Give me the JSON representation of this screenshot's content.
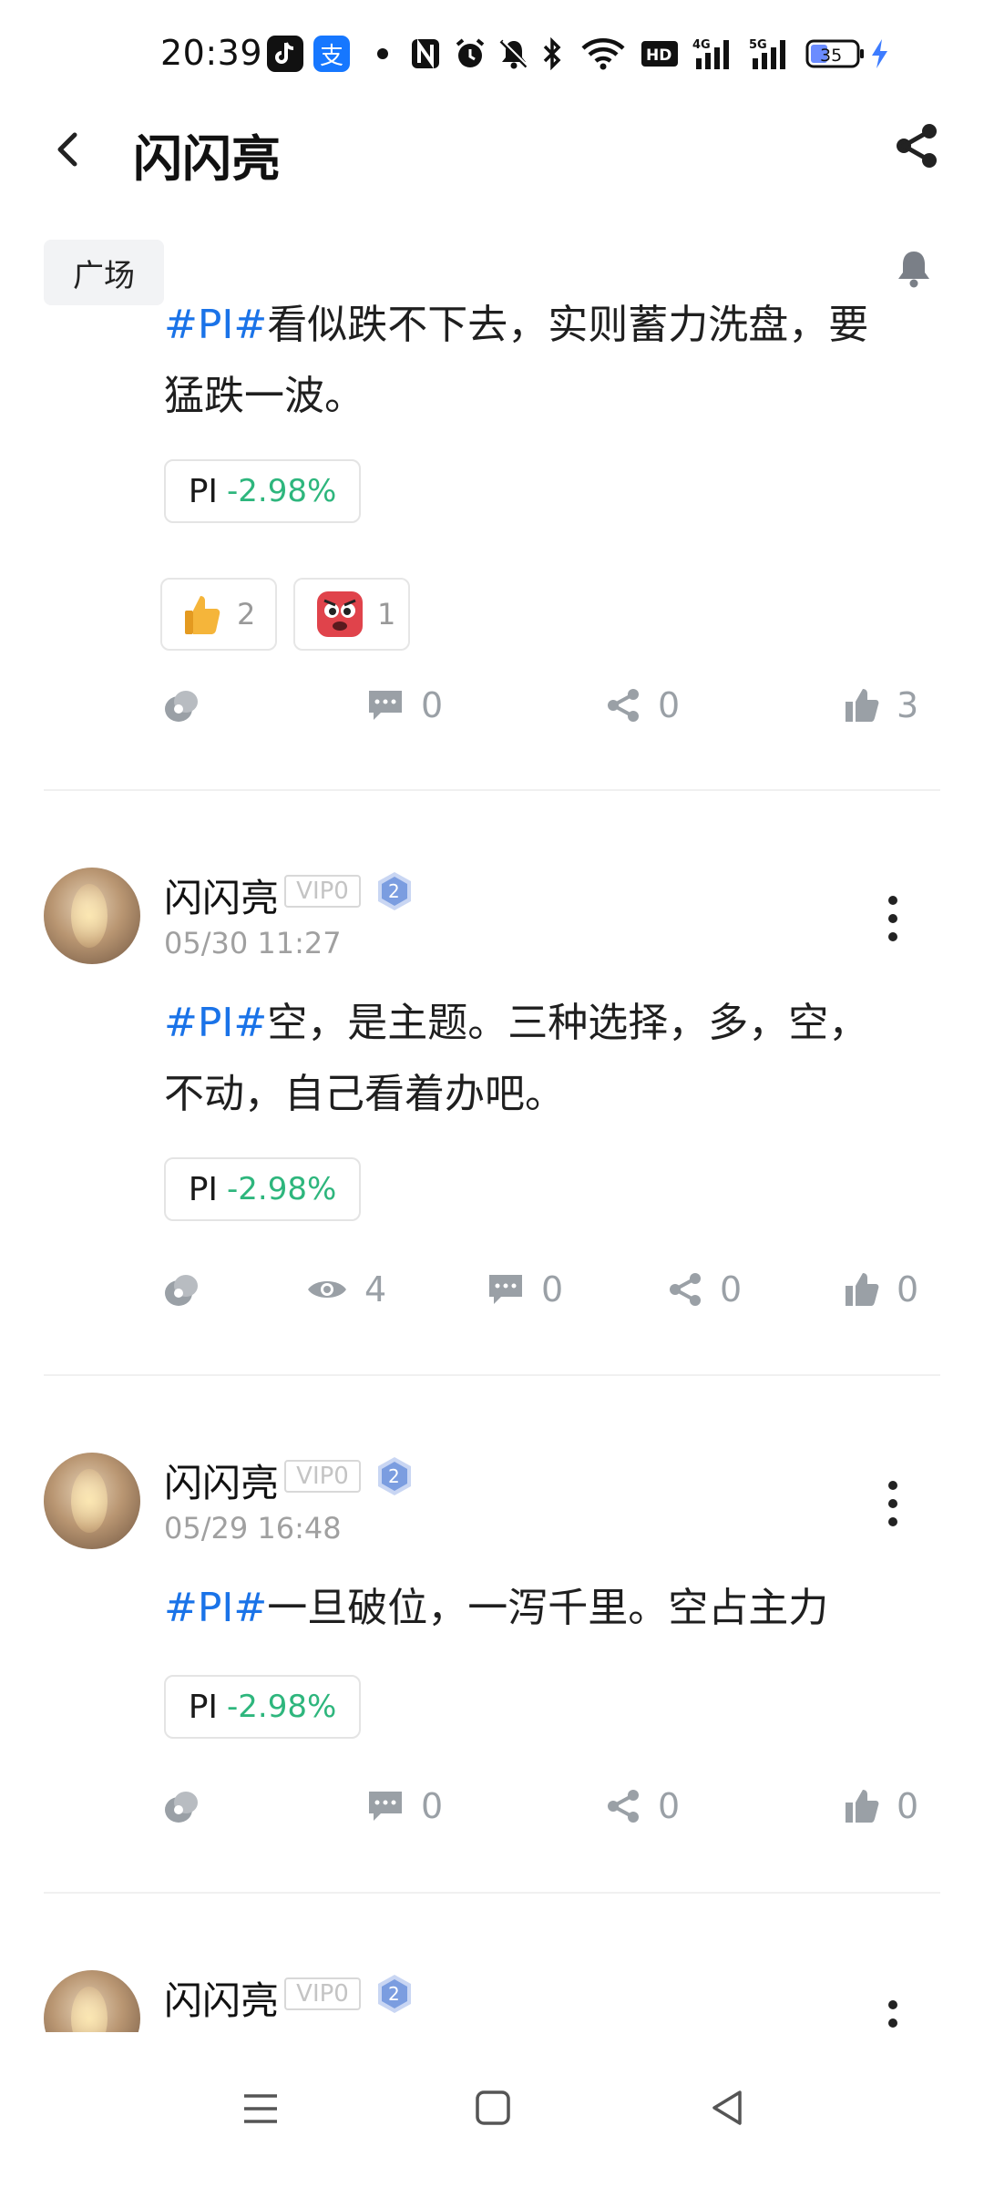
{
  "status_bar": {
    "time": "20:39",
    "battery": "35",
    "icons": [
      "tiktok-icon",
      "alipay-icon",
      "dot-icon",
      "nfc-icon",
      "alarm-icon",
      "mute-icon",
      "bluetooth-icon",
      "wifi-icon",
      "hd-icon",
      "signal-4g-icon",
      "signal-5g-icon",
      "battery-icon",
      "charging-icon"
    ],
    "alipay_glyph": "支"
  },
  "header": {
    "title": "闪闪亮"
  },
  "tag": {
    "label": "广场"
  },
  "posts": [
    {
      "hashtag": "#PI#",
      "text_line1": "看似跌不下去，实则蓄力洗盘，要",
      "text_line2": "猛跌一波。",
      "stock": {
        "name": "PI",
        "change": "-2.98%"
      },
      "reactions": [
        {
          "icon": "thumbs-up-emoji",
          "count": "2"
        },
        {
          "icon": "angry-face-emoji",
          "count": "1"
        }
      ],
      "actions": {
        "comments": "0",
        "shares": "0",
        "likes": "3"
      }
    },
    {
      "username": "闪闪亮",
      "vip": "VIP0",
      "level": "2",
      "date": "05/30 11:27",
      "hashtag": "#PI#",
      "text_line1": "空，是主题。三种选择，多，空，",
      "text_line2": "不动，自己看着办吧。",
      "stock": {
        "name": "PI",
        "change": "-2.98%"
      },
      "actions": {
        "views": "4",
        "comments": "0",
        "shares": "0",
        "likes": "0"
      }
    },
    {
      "username": "闪闪亮",
      "vip": "VIP0",
      "level": "2",
      "date": "05/29 16:48",
      "hashtag": "#PI#",
      "text_line1": "一旦破位，一泻千里。空占主力",
      "stock": {
        "name": "PI",
        "change": "-2.98%"
      },
      "actions": {
        "comments": "0",
        "shares": "0",
        "likes": "0"
      }
    },
    {
      "username": "闪闪亮",
      "vip": "VIP0",
      "level": "2"
    }
  ],
  "colors": {
    "hashtag": "#1a73e8",
    "negative_change": "#2eb67d",
    "icon_gray": "#9aa0a6"
  }
}
